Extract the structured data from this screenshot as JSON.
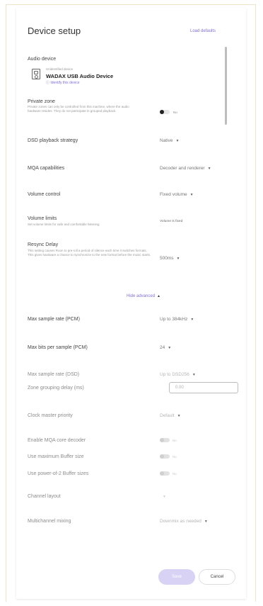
{
  "dialog": {
    "title": "Device setup",
    "load_defaults": "Load defaults"
  },
  "audio_device": {
    "label": "Audio device",
    "status": "Unidentified device",
    "name": "WADAX USB Audio Device",
    "identify": "Identify this device",
    "device_icon": "usb-speaker-icon"
  },
  "private_zone": {
    "label": "Private zone",
    "description": "Private zones can only be controlled from this machine, where the audio hardware resides. They do not participate in grouped playback.",
    "toggle_label": "No"
  },
  "dsd_strategy": {
    "label": "DSD playback strategy",
    "value": "Native"
  },
  "mqa": {
    "label": "MQA capabilities",
    "value": "Decoder and renderer"
  },
  "volume_control": {
    "label": "Volume control",
    "value": "Fixed volume"
  },
  "volume_limits": {
    "label": "Volume limits",
    "description": "Set volume limits for safe and comfortable listening",
    "value": "Volume is fixed"
  },
  "resync": {
    "label": "Resync Delay",
    "description": "This setting causes Roon to pre-roll a period of silence each time it switches formats. This gives hardware a chance to synchronize to the new format before the music starts.",
    "value": "500ms"
  },
  "hide_advanced": "Hide advanced",
  "advanced": {
    "max_rate_pcm": {
      "label": "Max sample rate (PCM)",
      "value": "Up to 384kHz"
    },
    "max_bits_pcm": {
      "label": "Max bits per sample (PCM)",
      "value": "24"
    },
    "max_rate_dsd": {
      "label": "Max sample rate (DSD)",
      "value": "Up to DSD256"
    },
    "zone_delay": {
      "label": "Zone grouping delay (ms)",
      "value": "0.00"
    },
    "clock_master": {
      "label": "Clock master priority",
      "value": "Default"
    },
    "mqa_core": {
      "label": "Enable MQA core decoder",
      "toggle_label": "No"
    },
    "max_buffer": {
      "label": "Use maximum Buffer size",
      "toggle_label": "No"
    },
    "pow2_buffer": {
      "label": "Use power-of-2 Buffer sizes",
      "toggle_label": "No"
    },
    "channel_layout": {
      "label": "Channel layout"
    },
    "multichannel": {
      "label": "Multichannel mixing",
      "value": "Downmix as needed"
    }
  },
  "buttons": {
    "save": "Save",
    "cancel": "Cancel"
  },
  "colors": {
    "accent": "#7e70d8",
    "save_bg": "#d8d2f5"
  }
}
